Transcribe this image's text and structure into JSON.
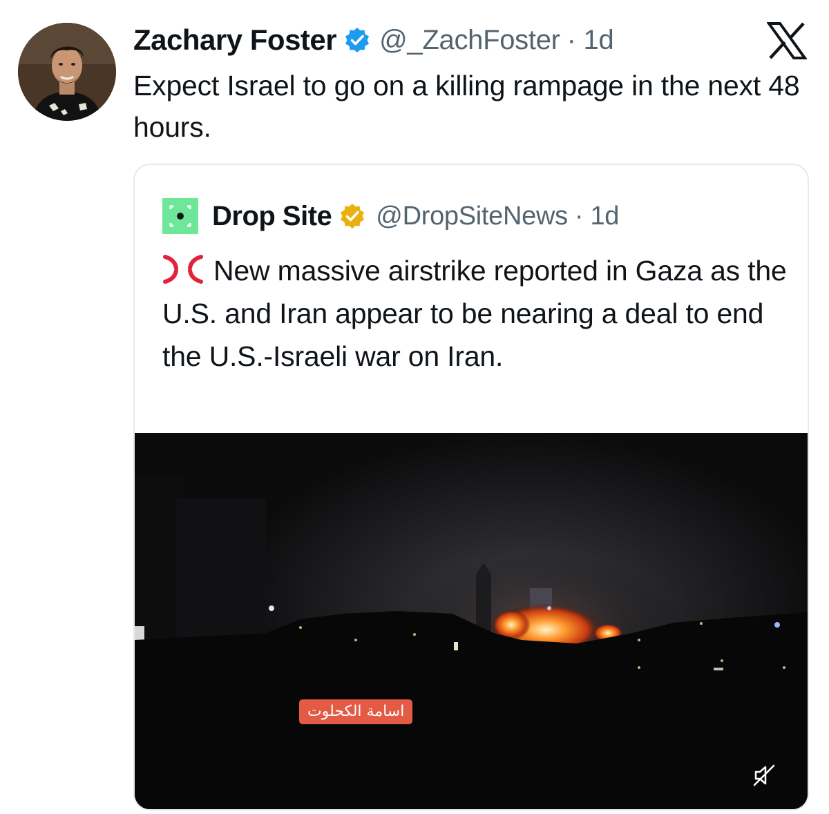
{
  "tweet": {
    "author_name": "Zachary Foster",
    "author_handle": "@_ZachFoster",
    "time": "· 1d",
    "text": "Expect Israel to go on a killing rampage in the next 48 hours.",
    "avatar_icon": "user-photo",
    "verified_badge_color": "#1d9bf0"
  },
  "brand": {
    "icon": "x-logo"
  },
  "quoted_tweet": {
    "author_name": "Drop Site",
    "author_handle": "@DropSiteNews",
    "time": "· 1d",
    "emoji_icon": "anger-symbol-icon",
    "text": "New massive airstrike reported in Gaza as the U.S. and Iran appear to be nearing a deal to end the U.S.-Israeli war on Iran.",
    "avatar_color": "#6ee79a",
    "verified_badge_color": "#e8b10f",
    "media": {
      "caption_tag": "اسامة الكحلوت",
      "caption_tag_color": "#e35a45",
      "mute_icon": "muted-speaker-icon"
    }
  }
}
